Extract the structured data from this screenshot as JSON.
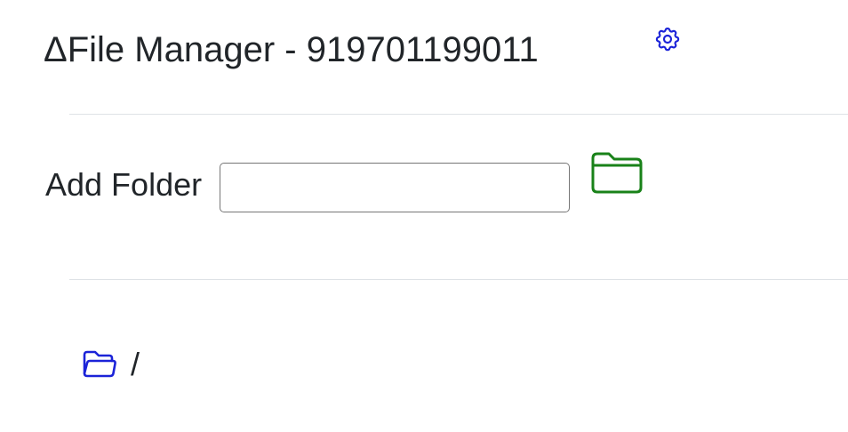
{
  "header": {
    "title": "ΔFile Manager - 919701199011",
    "settings_icon": "gear-icon"
  },
  "add_folder": {
    "label": "Add Folder",
    "input_value": "",
    "input_placeholder": "",
    "button_icon": "folder-icon"
  },
  "tree": {
    "root_icon": "folder-open-icon",
    "root_label": "/"
  },
  "colors": {
    "primary_blue": "#0d1fdb",
    "success_green": "#198219",
    "text": "#212529",
    "rule": "#dee2e6"
  }
}
